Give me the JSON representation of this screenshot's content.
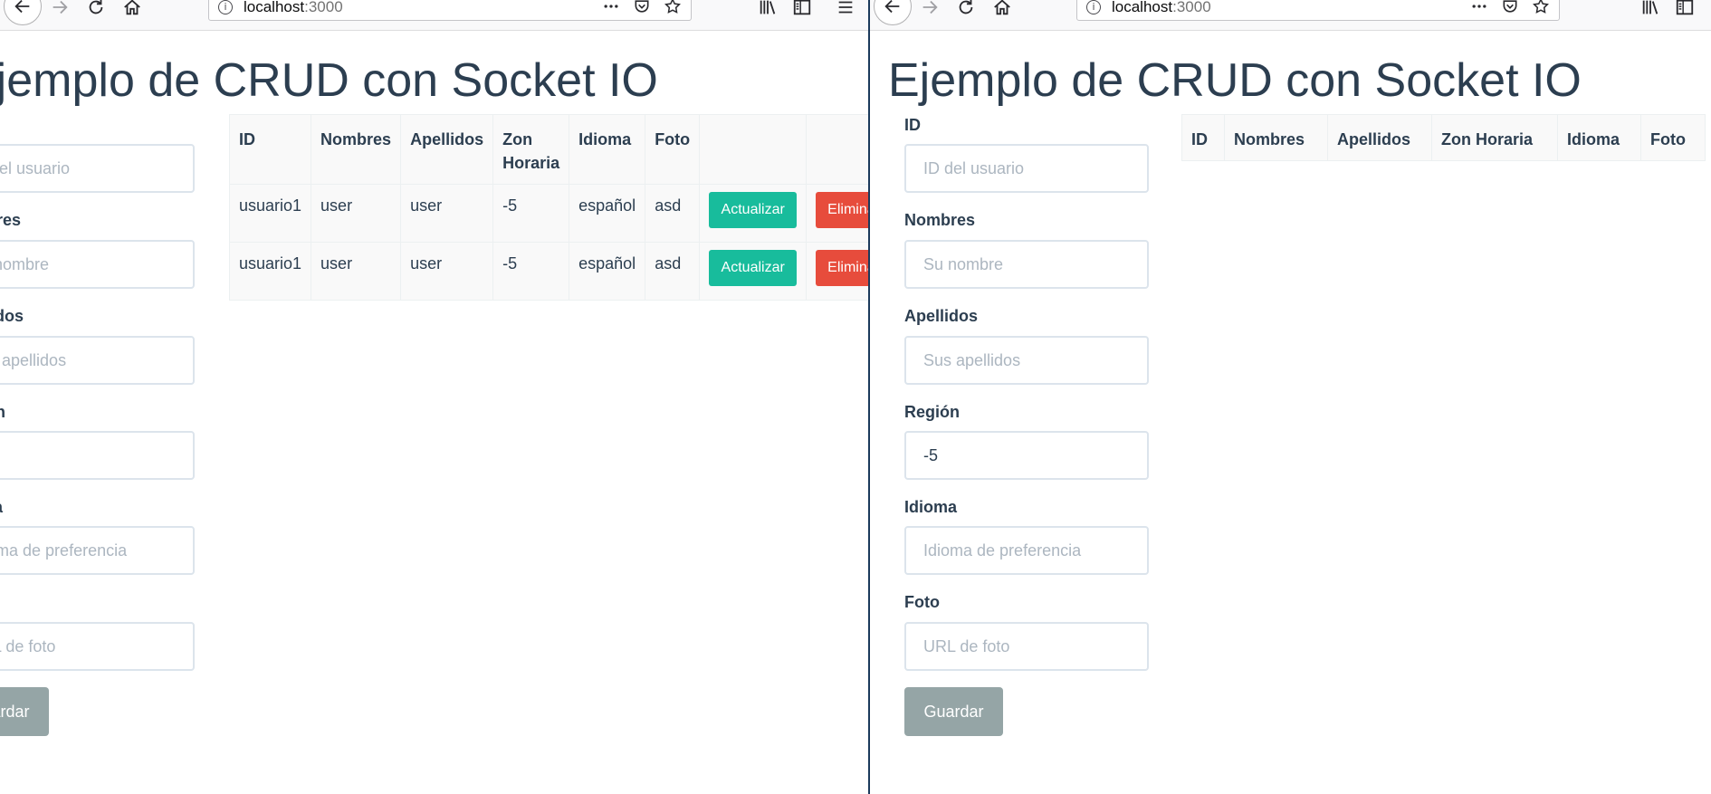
{
  "browser": {
    "url_host": "localhost",
    "url_port": ":3000"
  },
  "page": {
    "title": "Ejemplo de CRUD con Socket IO"
  },
  "form": {
    "id_label": "ID",
    "id_placeholder": "ID del usuario",
    "names_label": "Nombres",
    "names_placeholder": "Su nombre",
    "surnames_label": "Apellidos",
    "surnames_placeholder": "Sus apellidos",
    "region_label": "Región",
    "region_value": "-5",
    "language_label": "Idioma",
    "language_placeholder": "Idioma de preferencia",
    "photo_label": "Foto",
    "photo_placeholder": "URL de foto",
    "save_label": "Guardar"
  },
  "table": {
    "headers": {
      "id": "ID",
      "names": "Nombres",
      "surnames": "Apellidos",
      "timezone_line1": "Zon",
      "timezone_line2": "Horaria",
      "timezone": "Zon Horaria",
      "language": "Idioma",
      "photo": "Foto"
    },
    "rows": [
      {
        "id": "usuario1",
        "names": "user",
        "surnames": "user",
        "timezone": "-5",
        "language": "español",
        "photo": "asd",
        "update_label": "Actualizar",
        "delete_label": "Eliminar"
      },
      {
        "id": "usuario1",
        "names": "user",
        "surnames": "user",
        "timezone": "-5",
        "language": "español",
        "photo": "asd",
        "update_label": "Actualizar",
        "delete_label": "Eliminar"
      }
    ]
  }
}
